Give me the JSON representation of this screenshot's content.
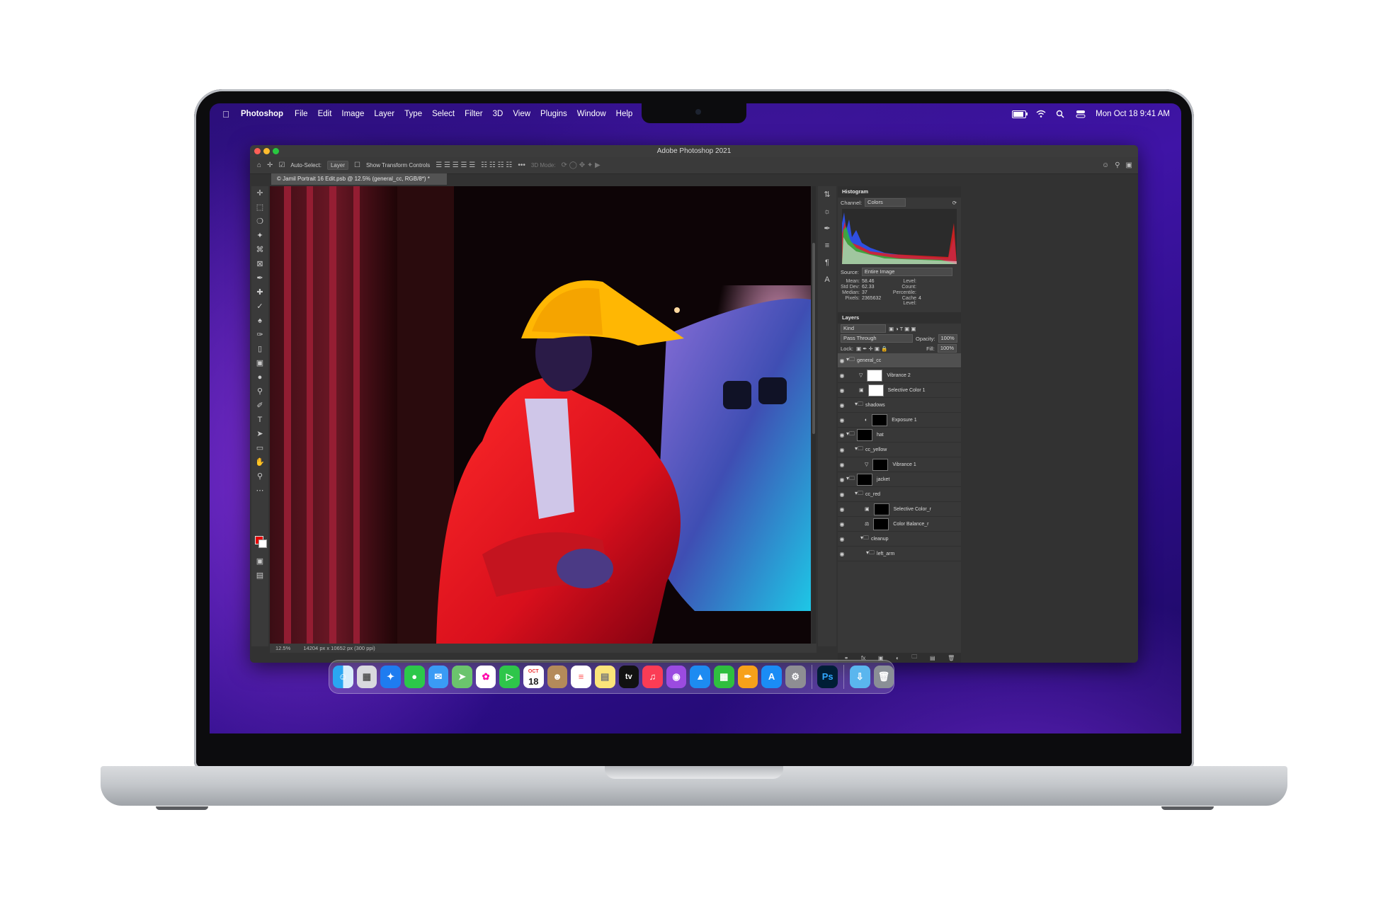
{
  "menubar": {
    "app_name": "Photoshop",
    "menus": [
      "File",
      "Edit",
      "Image",
      "Layer",
      "Type",
      "Select",
      "Filter",
      "3D",
      "View",
      "Plugins",
      "Window",
      "Help"
    ],
    "clock": "Mon Oct 18  9:41 AM"
  },
  "window": {
    "title": "Adobe Photoshop 2021"
  },
  "options_bar": {
    "auto_select_label": "Auto-Select:",
    "auto_select_value": "Layer",
    "show_transform_label": "Show Transform Controls",
    "mode_3d_label": "3D Mode:"
  },
  "document": {
    "tab_label": "© Jamil Portrait 16 Edit.psb @ 12.5% (general_cc, RGB/8*) *",
    "zoom": "12.5%",
    "dimensions": "14204 px x 10652 px (300 ppi)"
  },
  "histogram": {
    "title": "Histogram",
    "channel_label": "Channel:",
    "channel_value": "Colors",
    "source_label": "Source:",
    "source_value": "Entire Image",
    "stats_left": [
      [
        "Mean:",
        "58.46"
      ],
      [
        "Std Dev:",
        "62.33"
      ],
      [
        "Median:",
        "37"
      ],
      [
        "Pixels:",
        "2365632"
      ]
    ],
    "stats_right": [
      [
        "Level:",
        ""
      ],
      [
        "Count:",
        ""
      ],
      [
        "Percentile:",
        ""
      ],
      [
        "Cache Level:",
        "4"
      ]
    ]
  },
  "layers_panel": {
    "title": "Layers",
    "kind_value": "Kind",
    "blend_mode": "Pass Through",
    "opacity_label": "Opacity:",
    "opacity_value": "100%",
    "lock_label": "Lock:",
    "fill_label": "Fill:",
    "fill_value": "100%",
    "layers": [
      {
        "name": "general_cc",
        "type": "group",
        "thumb": "none"
      },
      {
        "name": "Vibrance 2",
        "type": "adjust",
        "thumb": "white"
      },
      {
        "name": "Selective Color 1",
        "type": "adjust",
        "thumb": "white"
      },
      {
        "name": "shadows",
        "type": "group",
        "thumb": "none"
      },
      {
        "name": "Exposure 1",
        "type": "adjust",
        "thumb": "black"
      },
      {
        "name": "hat",
        "type": "group",
        "thumb": "black"
      },
      {
        "name": "cc_yellow",
        "type": "group",
        "thumb": "none"
      },
      {
        "name": "Vibrance 1",
        "type": "adjust",
        "thumb": "black"
      },
      {
        "name": "jacket",
        "type": "group",
        "thumb": "black"
      },
      {
        "name": "cc_red",
        "type": "group",
        "thumb": "none"
      },
      {
        "name": "Selective Color_r",
        "type": "adjust",
        "thumb": "black"
      },
      {
        "name": "Color Balance_r",
        "type": "adjust",
        "thumb": "black"
      },
      {
        "name": "cleanup",
        "type": "group",
        "thumb": "none"
      },
      {
        "name": "left_arm",
        "type": "group",
        "thumb": "none"
      }
    ]
  },
  "dock": {
    "apps": [
      "Finder",
      "Launchpad",
      "Safari",
      "Messages",
      "Mail",
      "Maps",
      "Photos",
      "FaceTime",
      "Calendar",
      "Contacts",
      "Reminders",
      "Notes",
      "TV",
      "Music",
      "Podcasts",
      "Keynote",
      "Numbers",
      "Pages",
      "App Store",
      "System Preferences",
      "Photoshop",
      "Downloads",
      "Trash"
    ],
    "calendar_month": "OCT",
    "calendar_day": "18",
    "tv_label": "tv",
    "ps_label": "Ps"
  },
  "colors": {
    "accent": "#31a8ff",
    "foreground_swatch": "#e40000",
    "background_swatch": "#ffffff"
  }
}
